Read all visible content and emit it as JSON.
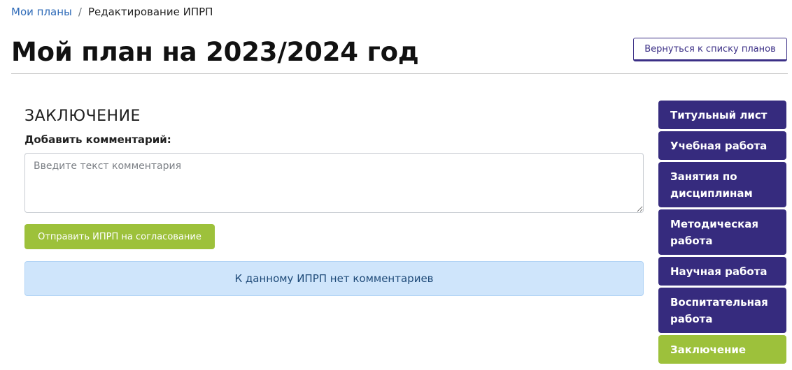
{
  "breadcrumb": {
    "root_label": "Мои планы",
    "separator": "/",
    "current_label": "Редактирование ИПРП"
  },
  "header": {
    "title": "Мой план на 2023/2024 год",
    "back_button_label": "Вернуться к списку планов"
  },
  "conclusion": {
    "heading": "ЗАКЛЮЧЕНИЕ",
    "comment_label": "Добавить комментарий:",
    "comment_value": "",
    "comment_placeholder": "Введите текст комментария",
    "submit_button_label": "Отправить ИПРП на согласование",
    "no_comments_message": "К данному ИПРП нет комментариев"
  },
  "sidebar": {
    "items": [
      {
        "label": "Титульный лист",
        "active": false
      },
      {
        "label": "Учебная работа",
        "active": false
      },
      {
        "label": "Занятия по дисциплинам",
        "active": false
      },
      {
        "label": "Методическая работа",
        "active": false
      },
      {
        "label": "Научная работа",
        "active": false
      },
      {
        "label": "Воспитательная работа",
        "active": false
      },
      {
        "label": "Заключение",
        "active": true
      }
    ]
  },
  "colors": {
    "brand_purple": "#362b7e",
    "accent_green": "#9dc13b",
    "link_blue": "#2f6bb8",
    "info_background": "#cfe5fb"
  }
}
